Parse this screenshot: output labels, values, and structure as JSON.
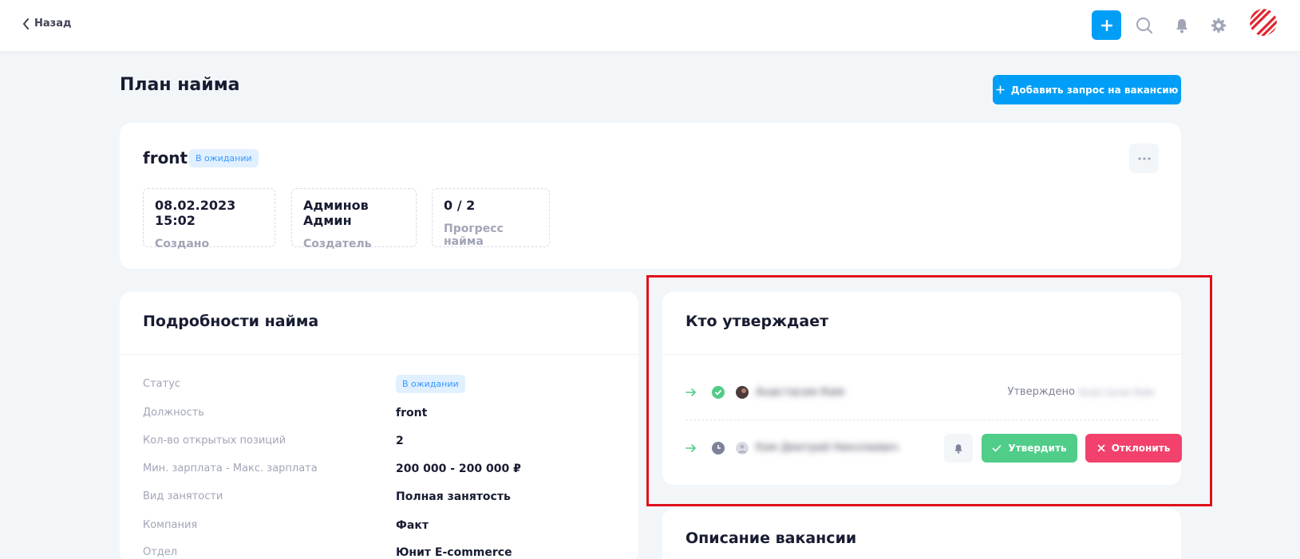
{
  "topbar": {
    "back_label": "Назад",
    "icons": [
      "plus-icon",
      "search-icon",
      "bell-icon",
      "gear-icon"
    ],
    "accent_color": "#009ef7"
  },
  "page": {
    "title": "План найма",
    "add_button_label": "Добавить запрос на вакансию"
  },
  "summary": {
    "title": "front",
    "status_badge": "В ожидании",
    "stats": [
      {
        "value": "08.02.2023 15:02",
        "label": "Создано"
      },
      {
        "value": "Админов Админ",
        "label": "Создатель"
      },
      {
        "value": "0 / 2",
        "label": "Прогресс найма"
      }
    ]
  },
  "details": {
    "title": "Подробности найма",
    "rows": [
      {
        "key": "Статус",
        "badge": "В ожидании"
      },
      {
        "key": "Должность",
        "value": "front"
      },
      {
        "key": "Кол-во открытых позиций",
        "value": "2"
      },
      {
        "key": "Мин. зарплата - Макс. зарплата",
        "value": "200 000 - 200 000 ₽"
      },
      {
        "key": "Вид занятости",
        "value": "Полная занятость"
      },
      {
        "key": "Компания",
        "value": "Факт"
      },
      {
        "key": "Отдел",
        "value": "Юнит E-commerce"
      }
    ]
  },
  "approvers": {
    "title": "Кто утверждает",
    "rows": [
      {
        "state": "approved",
        "name": "Анастасия Ким",
        "status_label": "Утверждено",
        "status_detail": "Анастасия Ким"
      },
      {
        "state": "pending",
        "name": "Ким Дмитрий Николаевич"
      }
    ],
    "approve_label": "Утвердить",
    "reject_label": "Отклонить",
    "colors": {
      "approve": "#50cd89",
      "reject": "#f1416c"
    }
  },
  "description": {
    "title": "Описание вакансии"
  }
}
